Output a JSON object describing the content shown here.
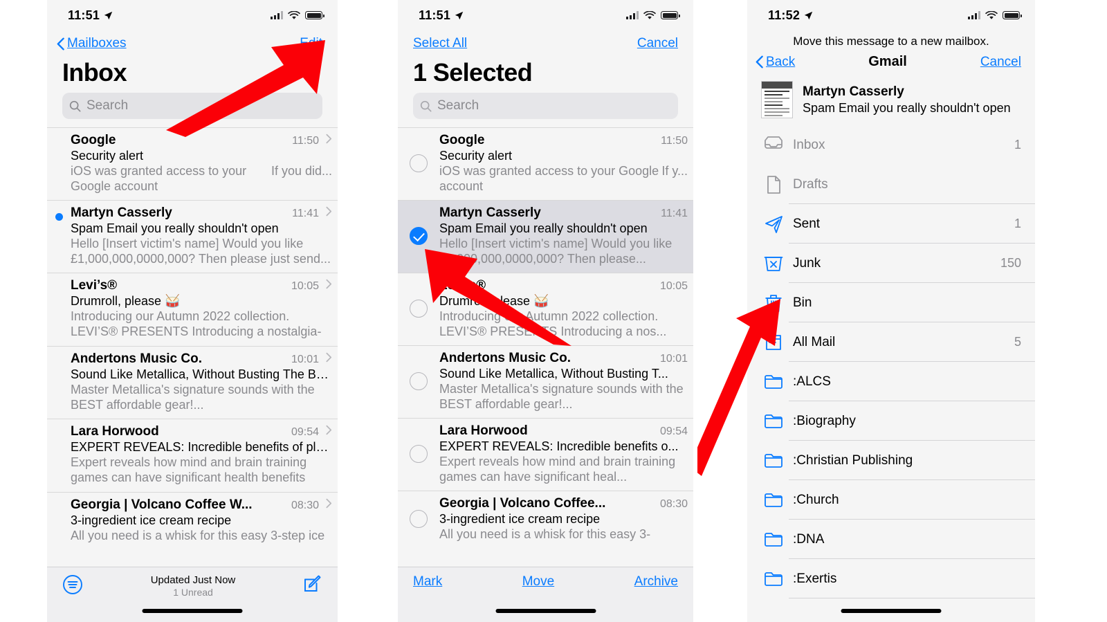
{
  "accent": "#0a7cff",
  "arrow_color": "#fb0007",
  "panel1": {
    "status": {
      "time": "11:51"
    },
    "nav": {
      "back_label": "Mailboxes",
      "edit_label": "Edit"
    },
    "title": "Inbox",
    "search_placeholder": "Search",
    "emails": [
      {
        "sender": "Google",
        "time": "11:50",
        "subject": "Security alert",
        "preview": "iOS was granted access to your Google account",
        "preview_tail": "If you did...",
        "unread": false
      },
      {
        "sender": "Martyn Casserly",
        "time": "11:41",
        "subject": "Spam Email you really shouldn't open",
        "preview": "Hello [Insert victim's name] Would you like £1,000,000,0000,000? Then please just send...",
        "preview_tail": "",
        "unread": true
      },
      {
        "sender": "Levi’s®",
        "time": "10:05",
        "subject": "Drumroll, please 🥁",
        "preview": "Introducing our Autumn 2022 collection. LEVI’S® PRESENTS Introducing a nostalgia-in...",
        "preview_tail": "",
        "unread": false
      },
      {
        "sender": "Andertons Music Co.",
        "time": "10:01",
        "subject": "Sound Like Metallica, Without Busting The Ba...",
        "preview": "Master Metallica's signature sounds with the BEST affordable gear!...",
        "preview_tail": "",
        "unread": false
      },
      {
        "sender": "Lara Horwood",
        "time": "09:54",
        "subject": "EXPERT REVEALS: Incredible benefits of playi...",
        "preview": "Expert reveals how mind and brain training games can have significant health benefits Th...",
        "preview_tail": "",
        "unread": false
      },
      {
        "sender": "Georgia | Volcano Coffee W...",
        "time": "08:30",
        "subject": "3-ingredient ice cream recipe",
        "preview": "All you need is a whisk for this easy 3-step ice",
        "preview_tail": "",
        "unread": false
      }
    ],
    "toolbar": {
      "status_main": "Updated Just Now",
      "status_sub": "1 Unread"
    }
  },
  "panel2": {
    "status": {
      "time": "11:51"
    },
    "nav": {
      "select_all_label": "Select All",
      "cancel_label": "Cancel"
    },
    "title": "1 Selected",
    "search_placeholder": "Search",
    "emails": [
      {
        "sender": "Google",
        "time": "11:50",
        "subject": "Security alert",
        "preview": "iOS was granted access to your Google account",
        "preview_tail": "If y...",
        "unread": false,
        "checked": false
      },
      {
        "sender": "Martyn Casserly",
        "time": "11:41",
        "subject": "Spam Email you really shouldn't open",
        "preview": "Hello [Insert victim's name] Would you like £1,000,000,0000,000? Then please...",
        "preview_tail": "",
        "unread": true,
        "checked": true
      },
      {
        "sender": "Levi’s®",
        "time": "10:05",
        "subject": "Drumroll, please 🥁",
        "preview": "Introducing our Autumn 2022 collection. LEVI’S® PRESENTS Introducing a nos...",
        "preview_tail": "",
        "unread": false,
        "checked": false
      },
      {
        "sender": "Andertons Music Co.",
        "time": "10:01",
        "subject": "Sound Like Metallica, Without Busting T...",
        "preview": "Master Metallica's signature sounds with the BEST affordable gear!...",
        "preview_tail": "",
        "unread": false,
        "checked": false
      },
      {
        "sender": "Lara Horwood",
        "time": "09:54",
        "subject": "EXPERT REVEALS: Incredible benefits o...",
        "preview": "Expert reveals how mind and brain training games can have significant heal...",
        "preview_tail": "",
        "unread": false,
        "checked": false
      },
      {
        "sender": "Georgia | Volcano Coffee...",
        "time": "08:30",
        "subject": "3-ingredient ice cream recipe",
        "preview": "All you need is a whisk for this easy 3-",
        "preview_tail": "",
        "unread": false,
        "checked": false
      }
    ],
    "toolbar": {
      "mark_label": "Mark",
      "move_label": "Move",
      "archive_label": "Archive"
    }
  },
  "panel3": {
    "status": {
      "time": "11:52"
    },
    "hint": "Move this message to a new mailbox.",
    "nav": {
      "back_label": "Back",
      "title": "Gmail",
      "cancel_label": "Cancel"
    },
    "message": {
      "sender": "Martyn Casserly",
      "subject": "Spam Email you really shouldn't open"
    },
    "mailboxes": [
      {
        "icon": "inbox-icon",
        "label": "Inbox",
        "count": "1",
        "dim": true
      },
      {
        "icon": "drafts-icon",
        "label": "Drafts",
        "count": "",
        "dim": true
      },
      {
        "icon": "sent-icon",
        "label": "Sent",
        "count": "1",
        "dim": false
      },
      {
        "icon": "junk-icon",
        "label": "Junk",
        "count": "150",
        "dim": false
      },
      {
        "icon": "bin-icon",
        "label": "Bin",
        "count": "",
        "dim": false
      },
      {
        "icon": "allmail-icon",
        "label": "All Mail",
        "count": "5",
        "dim": false
      },
      {
        "icon": "folder-icon",
        "label": ":ALCS",
        "count": "",
        "dim": false
      },
      {
        "icon": "folder-icon",
        "label": ":Biography",
        "count": "",
        "dim": false
      },
      {
        "icon": "folder-icon",
        "label": ":Christian Publishing",
        "count": "",
        "dim": false
      },
      {
        "icon": "folder-icon",
        "label": ":Church",
        "count": "",
        "dim": false
      },
      {
        "icon": "folder-icon",
        "label": ":DNA",
        "count": "",
        "dim": false
      },
      {
        "icon": "folder-icon",
        "label": ":Exertis",
        "count": "",
        "dim": false
      }
    ]
  }
}
